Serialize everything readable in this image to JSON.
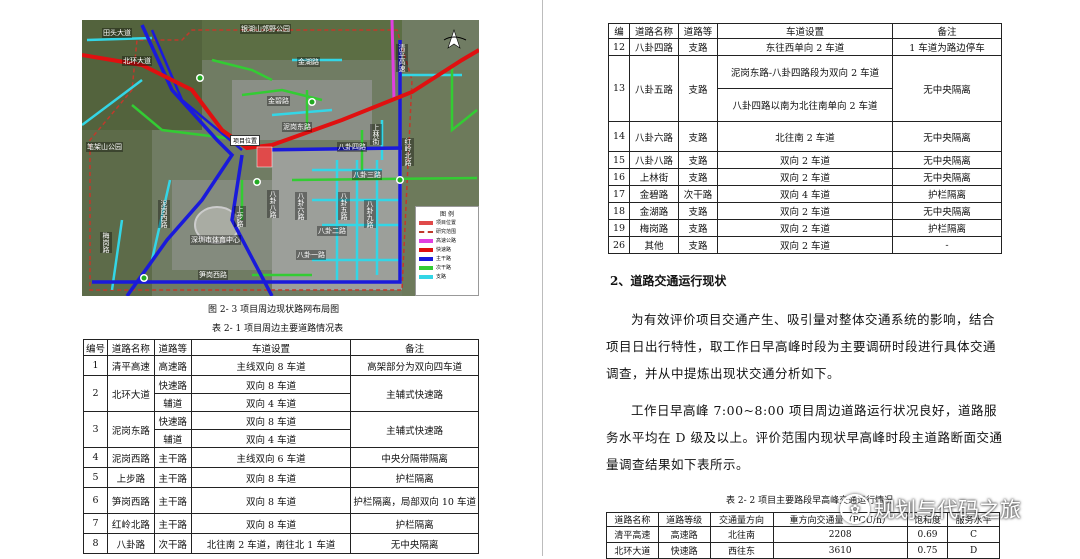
{
  "map": {
    "labels": {
      "tiantou_road": "田头大道",
      "north_park": "银湖山郊野公园",
      "beihuan": "北环大道",
      "qingping": "清平高速",
      "jinhu": "金湖路",
      "jinbi": "金碧路",
      "nigang_east": "泥岗东路",
      "bagua4": "八卦四路",
      "shanglin": "上林街",
      "bihuan_park": "笔架山公园",
      "bagua3": "八卦三路",
      "hongling": "红岭北路",
      "bagua_ba": "八卦八路",
      "bagua_liu": "八卦六路",
      "bagua_wu": "八卦五路",
      "bagua_jiu": "八卦九路",
      "bagua_yi": "八卦一路",
      "bagua_er": "八卦二路",
      "nigang_west": "泥岗西路",
      "meigang": "梅岗路",
      "shangbu": "上步路",
      "stadium": "深圳市体育中心",
      "sungang_west": "笋岗西路",
      "project": "项目位置"
    },
    "legend": {
      "title": "图 例",
      "items": [
        {
          "label": "项目位置",
          "color": "#e04a4a"
        },
        {
          "label": "研究范围",
          "color": "#c0392b"
        },
        {
          "label": "高速公路",
          "color": "#e040e0"
        },
        {
          "label": "快速路",
          "color": "#e01010"
        },
        {
          "label": "主干路",
          "color": "#1a1adb"
        },
        {
          "label": "次干路",
          "color": "#33cc33"
        },
        {
          "label": "支路",
          "color": "#33d6e6"
        }
      ]
    }
  },
  "left": {
    "figure_caption": "图 2- 3  项目周边现状路网布局图",
    "table_caption": "表 2- 1  项目周边主要道路情况表",
    "table1": {
      "headers": [
        "编号",
        "道路名称",
        "道路等",
        "车道设置",
        "备注"
      ],
      "rows": [
        {
          "no": "1",
          "name": "清平高速",
          "grade": "高速路",
          "lanes": "主线双向 8 车道",
          "note": "高架部分为双向四车道"
        },
        {
          "no": "2",
          "name": "北环大道",
          "sub": [
            {
              "grade": "快速路",
              "lanes": "双向 8 车道"
            },
            {
              "grade": "辅道",
              "lanes": "双向 4 车道"
            }
          ],
          "note": "主辅式快速路"
        },
        {
          "no": "3",
          "name": "泥岗东路",
          "sub": [
            {
              "grade": "快速路",
              "lanes": "双向 8 车道"
            },
            {
              "grade": "辅道",
              "lanes": "双向 4 车道"
            }
          ],
          "note": "主辅式快速路"
        },
        {
          "no": "4",
          "name": "泥岗西路",
          "grade": "主干路",
          "lanes": "主线双向 6 车道",
          "note": "中央分隔带隔离"
        },
        {
          "no": "5",
          "name": "上步路",
          "grade": "主干路",
          "lanes": "双向 8 车道",
          "note": "护栏隔离"
        },
        {
          "no": "6",
          "name": "笋岗西路",
          "grade": "主干路",
          "lanes": "双向 8 车道",
          "note": "护栏隔离，局部双向 10 车道"
        },
        {
          "no": "7",
          "name": "红岭北路",
          "grade": "主干路",
          "lanes": "双向 8 车道",
          "note": "护栏隔离"
        },
        {
          "no": "8",
          "name": "八卦路",
          "grade": "次干路",
          "lanes": "北往南 2 车道，南往北 1 车道",
          "note": "无中央隔离"
        }
      ]
    }
  },
  "right": {
    "table_cont": {
      "headers": [
        "编",
        "道路名称",
        "道路等",
        "车道设置",
        "备注"
      ],
      "rows": [
        {
          "no": "12",
          "name": "八卦四路",
          "grade": "支路",
          "lanes": "东往西单向 2 车道",
          "note": "1 车道为路边停车"
        },
        {
          "no": "13",
          "name": "八卦五路",
          "grade": "支路",
          "lanes_a": "泥岗东路-八卦四路段为双向 2 车道",
          "lanes_b": "八卦四路以南为北往南单向 2 车道",
          "note": "无中央隔离"
        },
        {
          "no": "14",
          "name": "八卦六路",
          "grade": "支路",
          "lanes": "北往南 2 车道",
          "note": "无中央隔离"
        },
        {
          "no": "15",
          "name": "八卦八路",
          "grade": "支路",
          "lanes": "双向 2 车道",
          "note": "无中央隔离"
        },
        {
          "no": "16",
          "name": "上林街",
          "grade": "支路",
          "lanes": "双向 2 车道",
          "note": "无中央隔离"
        },
        {
          "no": "17",
          "name": "金碧路",
          "grade": "次干路",
          "lanes": "双向 4 车道",
          "note": "护栏隔离"
        },
        {
          "no": "18",
          "name": "金湖路",
          "grade": "支路",
          "lanes": "双向 2 车道",
          "note": "无中央隔离"
        },
        {
          "no": "19",
          "name": "梅岗路",
          "grade": "支路",
          "lanes": "双向 2 车道",
          "note": "护栏隔离"
        },
        {
          "no": "26",
          "name": "其他",
          "grade": "支路",
          "lanes": "双向 2 车道",
          "note": "-"
        }
      ]
    },
    "heading": "2、道路交通运行现状",
    "para1": "为有效评价项目交通产生、吸引量对整体交通系统的影响，结合项目日出行特性，取工作日早高峰时段为主要调研时段进行具体交通调查，并从中提炼出现状交通分析如下。",
    "para2": "工作日早高峰 7:00~8:00 项目周边道路运行状况良好，道路服务水平均在 D 级及以上。评价范围内现状早高峰时段主道路断面交通量调查结果如下表所示。",
    "table2_caption": "表 2- 2  项目主要路段早高峰交通运行情况",
    "table2": {
      "headers": [
        "道路名称",
        "道路等级",
        "交通量方向",
        "重方向交通量（PCU/h）",
        "饱和度",
        "服务水平"
      ],
      "rows": [
        [
          "清平高速",
          "高速路",
          "北往南",
          "2208",
          "0.69",
          "C"
        ],
        [
          "北环大道",
          "快速路",
          "西往东",
          "3610",
          "0.75",
          "D"
        ]
      ]
    },
    "watermark": "规划与代码之旅"
  }
}
